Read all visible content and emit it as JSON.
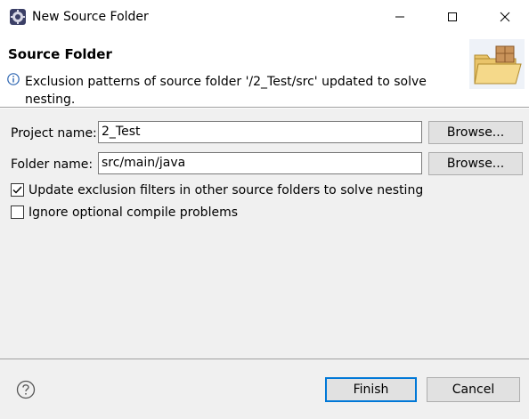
{
  "window": {
    "title": "New Source Folder",
    "icons": {
      "app": "eclipse-gear-icon",
      "minimize": "minimize-icon",
      "maximize": "maximize-icon",
      "close": "close-icon"
    }
  },
  "header": {
    "title": "Source Folder",
    "message": "Exclusion patterns of source folder '/2_Test/src' updated to solve nesting.",
    "icons": {
      "info": "info-icon",
      "banner": "folder-package-icon"
    }
  },
  "form": {
    "project_label": "Project name:",
    "project_value": "2_Test",
    "folder_label": "Folder name:",
    "folder_value": "src/main/java",
    "browse_label": "Browse...",
    "checkbox_update_label": "Update exclusion filters in other source folders to solve nesting",
    "checkbox_update_checked": true,
    "checkbox_ignore_label": "Ignore optional compile problems",
    "checkbox_ignore_checked": false
  },
  "footer": {
    "finish_label": "Finish",
    "cancel_label": "Cancel",
    "icons": {
      "help": "help-icon"
    }
  },
  "colors": {
    "dialog_bg": "#f0f0f0",
    "accent": "#0078d7",
    "button_bg": "#e1e1e1"
  }
}
